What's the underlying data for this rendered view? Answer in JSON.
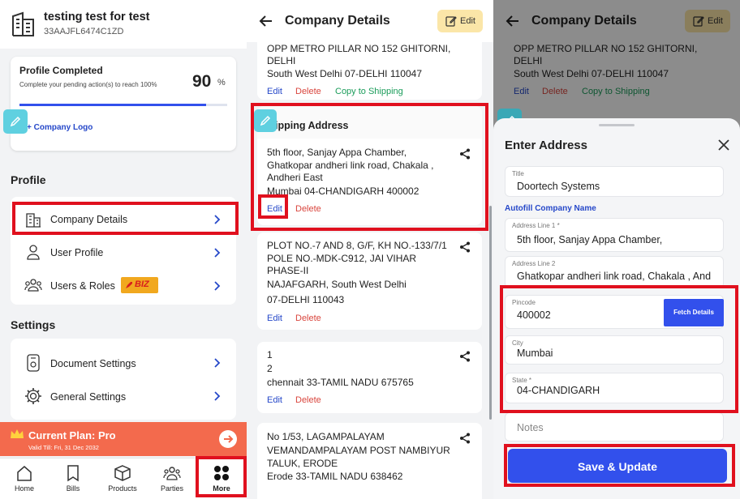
{
  "colors": {
    "highlight": "#e0101e",
    "primary": "#3250ec",
    "plan": "#f36a4d",
    "accent_blue": "#2648c9",
    "delete_red": "#d9453d",
    "green": "#1a9c5a",
    "edit_yellow": "#fbe6a8"
  },
  "left": {
    "business_name": "testing test for test",
    "gstin": "33AAJFL6474C1ZD",
    "profile_card": {
      "title": "Profile Completed",
      "subtitle": "Complete your pending action(s) to reach 100%",
      "percent": "90",
      "percent_sign": "%",
      "progress": 0.9,
      "link": "+ Company Logo"
    },
    "profile_section": "Profile",
    "profile_items": [
      {
        "label": "Company Details",
        "icon": "building-icon"
      },
      {
        "label": "User Profile",
        "icon": "user-icon"
      },
      {
        "label": "Users & Roles",
        "icon": "users-icon",
        "badge": "BIZ"
      }
    ],
    "settings_section": "Settings",
    "settings_items": [
      {
        "label": "Document Settings",
        "icon": "document-icon"
      },
      {
        "label": "General Settings",
        "icon": "gear-icon"
      }
    ],
    "plan": {
      "title": "Current Plan: Pro",
      "valid": "Valid Till: Fri, 31 Dec 2032"
    },
    "nav": [
      "Home",
      "Bills",
      "Products",
      "Parties",
      "More"
    ]
  },
  "middle": {
    "title": "Company Details",
    "edit": "Edit",
    "address0": {
      "lines": [
        "OPP METRO PILLAR NO 152 GHITORNI,",
        "DELHI",
        "South West Delhi 07-DELHI 110047"
      ],
      "edit": "Edit",
      "delete": "Delete",
      "copy": "Copy to Shipping"
    },
    "shipping_title": "Shipping Address",
    "address1": {
      "lines": [
        "5th floor, Sanjay Appa Chamber,",
        "Ghatkopar andheri link road, Chakala ,",
        "Andheri East",
        "Mumbai 04-CHANDIGARH 400002"
      ],
      "edit": "Edit",
      "delete": "Delete"
    },
    "address2": {
      "lines": [
        "PLOT NO.-7 AND 8, G/F, KH NO.-133/7/1",
        "POLE NO.-MDK-C912, JAI VIHAR",
        "PHASE-II",
        "NAJAFGARH, South West Delhi",
        "07-DELHI 110043"
      ],
      "edit": "Edit",
      "delete": "Delete"
    },
    "address3": {
      "lines": [
        "1",
        "2",
        "chennait 33-TAMIL NADU 675765"
      ],
      "edit": "Edit",
      "delete": "Delete"
    },
    "address4": {
      "lines": [
        "No 1/53, LAGAMPALAYAM",
        "VEMANDAMPALAYAM POST NAMBIYUR",
        "TALUK, ERODE",
        "Erode 33-TAMIL NADU 638462"
      ]
    }
  },
  "right": {
    "sheet_title": "Enter Address",
    "title_label": "Title",
    "title_value": "Doortech Systems",
    "autofill": "Autofill Company Name",
    "addr1_label": "Address Line 1 *",
    "addr1_value": "5th floor, Sanjay Appa Chamber,",
    "addr2_label": "Address Line 2",
    "addr2_value": "Ghatkopar andheri link road, Chakala , And",
    "pincode_label": "Pincode",
    "pincode_value": "400002",
    "fetch": "Fetch Details",
    "city_label": "City",
    "city_value": "Mumbai",
    "state_label": "State *",
    "state_value": "04-CHANDIGARH",
    "notes_placeholder": "Notes",
    "save": "Save & Update"
  }
}
